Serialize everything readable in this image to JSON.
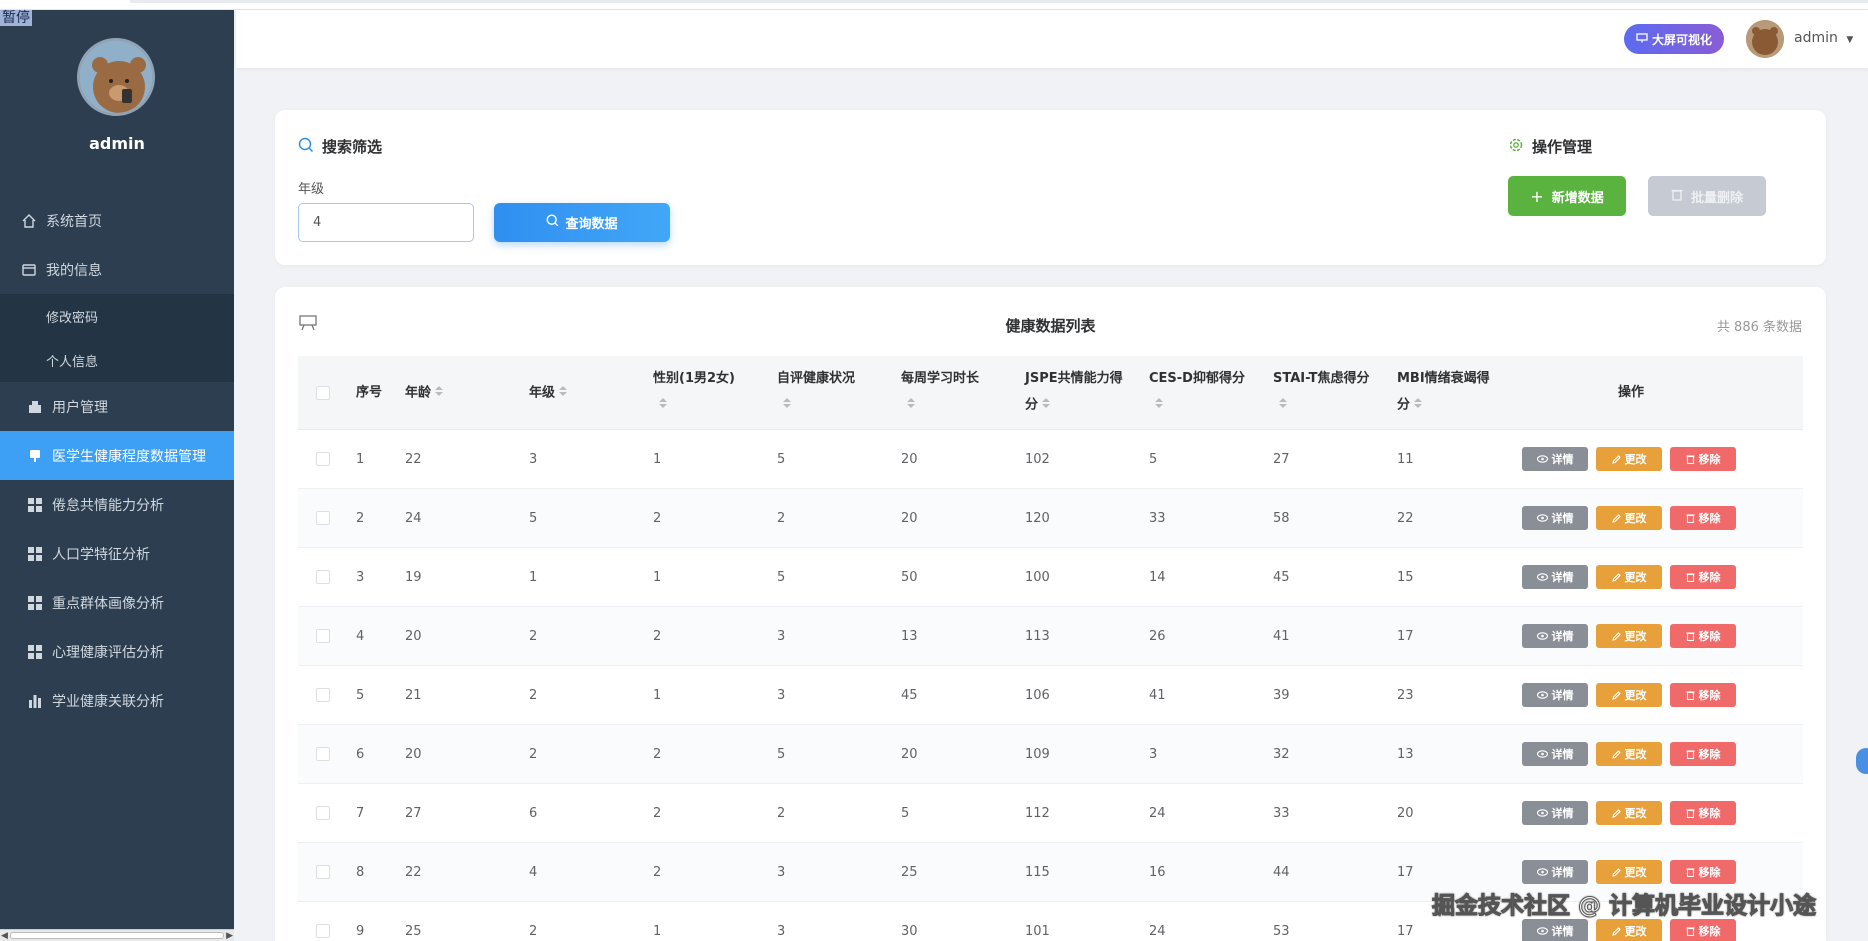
{
  "corner": "暂停",
  "sidebar": {
    "username": "admin",
    "items": [
      {
        "label": "系统首页",
        "icon": "home-icon"
      },
      {
        "label": "我的信息",
        "icon": "wallet-icon"
      },
      {
        "label": "修改密码",
        "sub": true
      },
      {
        "label": "个人信息",
        "sub": true
      },
      {
        "label": "用户管理",
        "icon": "user-manage-icon"
      },
      {
        "label": "医学生健康程度数据管理",
        "icon": "data-icon",
        "active": true
      },
      {
        "label": "倦怠共情能力分析",
        "icon": "grid-icon"
      },
      {
        "label": "人口学特征分析",
        "icon": "grid-icon"
      },
      {
        "label": "重点群体画像分析",
        "icon": "grid-icon"
      },
      {
        "label": "心理健康评估分析",
        "icon": "grid-icon"
      },
      {
        "label": "学业健康关联分析",
        "icon": "bar-chart-icon"
      }
    ]
  },
  "header": {
    "viz_button": "大屏可视化",
    "username": "admin"
  },
  "search": {
    "title": "搜索筛选",
    "grade_label": "年级",
    "grade_value": "4",
    "query_button": "查询数据"
  },
  "ops": {
    "title": "操作管理",
    "add_button": "新增数据",
    "bulk_delete_button": "批量删除"
  },
  "table": {
    "title": "健康数据列表",
    "count_text": "共 886 条数据",
    "headers": {
      "index": "序号",
      "age": "年龄",
      "grade": "年级",
      "gender": "性别(1男2女)",
      "health": "自评健康状况",
      "study": "每周学习时长",
      "jspe_1": "JSPE共情能力得",
      "jspe_2": "分",
      "cesd": "CES-D抑郁得分",
      "stai": "STAI-T焦虑得分",
      "mbi_1": "MBI情绪衰竭得",
      "mbi_2": "分",
      "ops": "操作"
    },
    "action_labels": {
      "detail": "详情",
      "edit": "更改",
      "delete": "移除"
    },
    "rows": [
      {
        "index": "1",
        "age": "22",
        "grade": "3",
        "gender": "1",
        "health": "5",
        "study": "20",
        "jspe": "102",
        "cesd": "5",
        "stai": "27",
        "mbi": "11"
      },
      {
        "index": "2",
        "age": "24",
        "grade": "5",
        "gender": "2",
        "health": "2",
        "study": "20",
        "jspe": "120",
        "cesd": "33",
        "stai": "58",
        "mbi": "22"
      },
      {
        "index": "3",
        "age": "19",
        "grade": "1",
        "gender": "1",
        "health": "5",
        "study": "50",
        "jspe": "100",
        "cesd": "14",
        "stai": "45",
        "mbi": "15"
      },
      {
        "index": "4",
        "age": "20",
        "grade": "2",
        "gender": "2",
        "health": "3",
        "study": "13",
        "jspe": "113",
        "cesd": "26",
        "stai": "41",
        "mbi": "17"
      },
      {
        "index": "5",
        "age": "21",
        "grade": "2",
        "gender": "1",
        "health": "3",
        "study": "45",
        "jspe": "106",
        "cesd": "41",
        "stai": "39",
        "mbi": "23"
      },
      {
        "index": "6",
        "age": "20",
        "grade": "2",
        "gender": "2",
        "health": "5",
        "study": "20",
        "jspe": "109",
        "cesd": "3",
        "stai": "32",
        "mbi": "13"
      },
      {
        "index": "7",
        "age": "27",
        "grade": "6",
        "gender": "2",
        "health": "2",
        "study": "5",
        "jspe": "112",
        "cesd": "24",
        "stai": "33",
        "mbi": "20"
      },
      {
        "index": "8",
        "age": "22",
        "grade": "4",
        "gender": "2",
        "health": "3",
        "study": "25",
        "jspe": "115",
        "cesd": "16",
        "stai": "44",
        "mbi": "17"
      },
      {
        "index": "9",
        "age": "25",
        "grade": "2",
        "gender": "1",
        "health": "3",
        "study": "30",
        "jspe": "101",
        "cesd": "24",
        "stai": "53",
        "mbi": "17"
      }
    ]
  },
  "watermark": "掘金技术社区 @ 计算机毕业设计小途"
}
